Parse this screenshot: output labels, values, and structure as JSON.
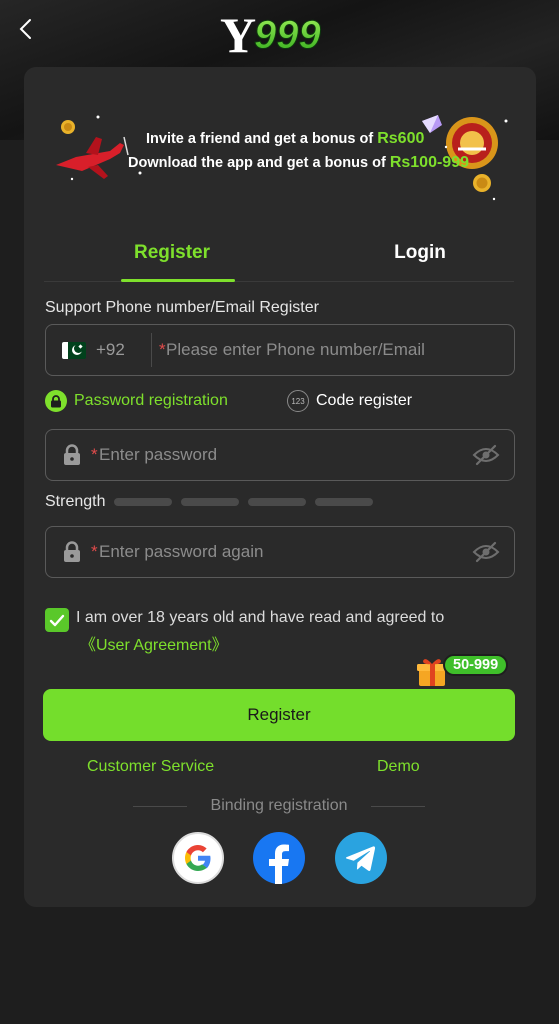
{
  "header": {
    "back_icon": "chevron-left-icon",
    "logo_text": "Y999"
  },
  "banner": {
    "line1_prefix": "Invite a friend and get a bonus of",
    "line1_amount": "Rs600",
    "line2_prefix": "Download the app and get a bonus of",
    "line2_amount": "Rs100-999"
  },
  "tabs": [
    {
      "label": "Register",
      "active": true
    },
    {
      "label": "Login",
      "active": false
    }
  ],
  "form": {
    "support_label": "Support Phone number/Email Register",
    "country_code": "+92",
    "country_flag": "pakistan-flag-icon",
    "phone_required_mark": "*",
    "phone_placeholder": "Please enter Phone number/Email",
    "mode_password": "Password registration",
    "mode_code": "Code register",
    "mode_code_icon_text": "123",
    "password_required_mark": "*",
    "password_placeholder": "Enter password",
    "strength_label": "Strength",
    "strength_level": 0,
    "password_again_required_mark": "*",
    "password_again_placeholder": "Enter password again",
    "agree_checked": true,
    "agree_text": "I am over 18 years old and have read and agreed to",
    "agree_link": "《User Agreement》",
    "bonus_badge": "50-999",
    "register_button": "Register"
  },
  "links": {
    "customer_service": "Customer Service",
    "demo": "Demo"
  },
  "binding": {
    "label": "Binding registration",
    "providers": [
      "google-icon",
      "facebook-icon",
      "telegram-icon"
    ]
  },
  "colors": {
    "accent": "#7ee02c",
    "button": "#74de2c",
    "card": "#2a2a2a",
    "background": "#1e1e1e"
  }
}
